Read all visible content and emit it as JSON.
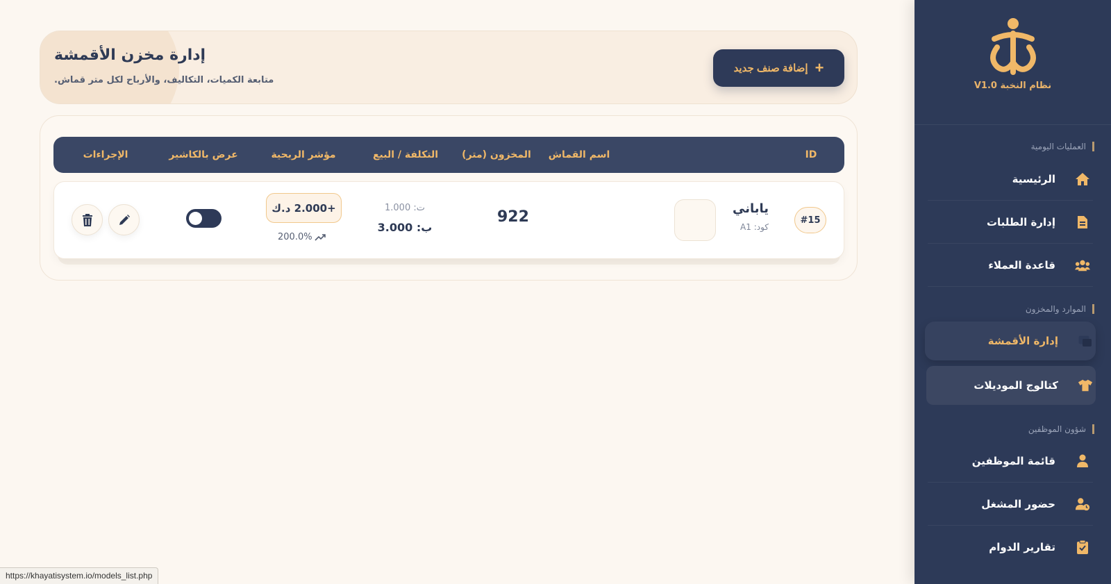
{
  "sidebar": {
    "brand_name": "نظام النخبة V1.0",
    "sections": [
      {
        "title": "العمليات اليومية"
      },
      {
        "title": "الموارد والمخزون"
      },
      {
        "title": "شؤون الموظفين"
      }
    ],
    "items": [
      {
        "label": "الرئيسية",
        "icon": "home-icon"
      },
      {
        "label": "إدارة الطلبات",
        "icon": "document-icon"
      },
      {
        "label": "قاعدة العملاء",
        "icon": "users-icon"
      },
      {
        "label": "إدارة الأقمشة",
        "icon": "fabric-icon",
        "active": true
      },
      {
        "label": "كتالوج الموديلات",
        "icon": "shirt-icon"
      },
      {
        "label": "قائمة الموظفين",
        "icon": "user-icon"
      },
      {
        "label": "حضور المشغل",
        "icon": "user-clock-icon"
      },
      {
        "label": "تقارير الدوام",
        "icon": "clipboard-check-icon"
      }
    ],
    "accent_color": "#f0b868",
    "background_color": "#2d3a58"
  },
  "header": {
    "title": "إدارة مخزن الأقمشة",
    "subtitle": "متابعة الكميات، التكاليف، والأرباح لكل متر قماش.",
    "add_button_label": "إضافة صنف جديد"
  },
  "table": {
    "columns": [
      "ID",
      "اسم القماش",
      "المخزون (متر)",
      "التكلفة / البيع",
      "مؤشر الربحية",
      "عرض بالكاشير",
      "الإجراءات"
    ],
    "rows": [
      {
        "id": "#15",
        "name": "ياباني",
        "code": "كود: A1",
        "stock": "922",
        "cost": "ت: 1.000",
        "sell": "ب: 3.000",
        "profit": "+2.000 د.ك",
        "profit_percent": "200.0%",
        "cashier_visible": true
      }
    ]
  },
  "status_bar": {
    "url": "https://khayatisystem.io/models_list.php"
  }
}
